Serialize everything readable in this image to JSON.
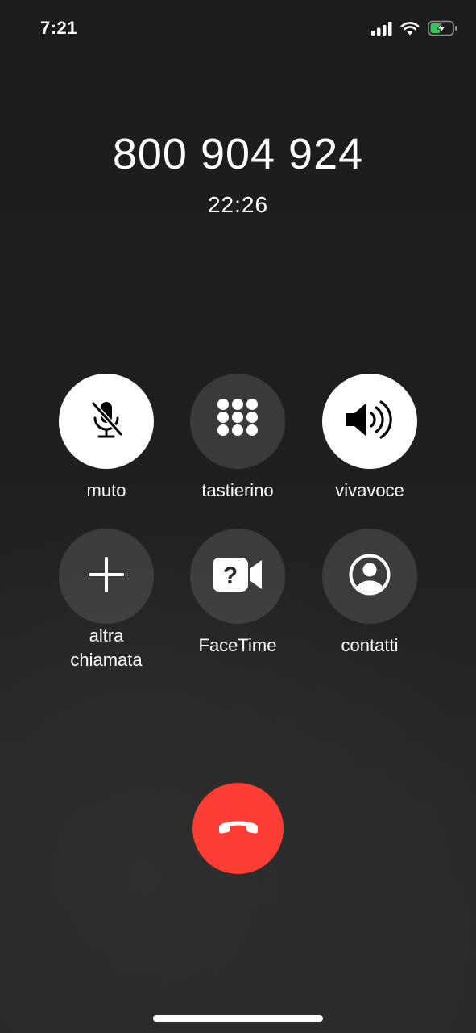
{
  "status_bar": {
    "time": "7:21",
    "icons": [
      "cellular-signal-icon",
      "wifi-icon",
      "battery-charging-icon"
    ],
    "battery_color": "#34c759"
  },
  "call": {
    "number": "800 904 924",
    "duration": "22:26"
  },
  "controls": {
    "mute": {
      "label": "muto",
      "icon": "mic-slash-icon",
      "active": true
    },
    "keypad": {
      "label": "tastierino",
      "icon": "keypad-icon",
      "active": false
    },
    "speaker": {
      "label": "vivavoce",
      "icon": "speaker-wave-icon",
      "active": true
    },
    "add_call": {
      "label": "altra\nchiamata",
      "icon": "plus-icon",
      "active": false
    },
    "facetime": {
      "label": "FaceTime",
      "icon": "facetime-question-icon",
      "active": false
    },
    "contacts": {
      "label": "contatti",
      "icon": "person-circle-icon",
      "active": false
    }
  },
  "end_call": {
    "icon": "phone-down-icon",
    "color": "#fb3d34"
  }
}
